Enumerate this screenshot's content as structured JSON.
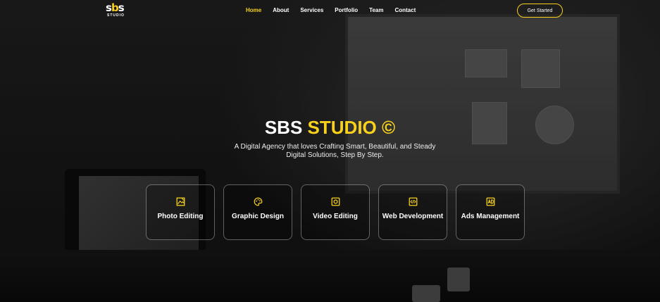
{
  "brand": {
    "logo_main": "sbs",
    "logo_sub": "STUDIO",
    "accent": "#f7d11b"
  },
  "nav": {
    "items": [
      {
        "label": "Home",
        "active": true
      },
      {
        "label": "About",
        "active": false
      },
      {
        "label": "Services",
        "active": false
      },
      {
        "label": "Portfolio",
        "active": false
      },
      {
        "label": "Team",
        "active": false
      },
      {
        "label": "Contact",
        "active": false
      }
    ],
    "cta_label": "Get Started"
  },
  "hero": {
    "title_white": "SBS",
    "title_yellow": "STUDIO ©",
    "subtitle_line1": "A Digital Agency that loves Crafting Smart, Beautiful, and Steady",
    "subtitle_line2": "Digital Solutions, Step By Step."
  },
  "services": [
    {
      "label": "Photo Editing",
      "icon": "image-edit-icon"
    },
    {
      "label": "Graphic Design",
      "icon": "palette-icon"
    },
    {
      "label": "Video Editing",
      "icon": "video-icon"
    },
    {
      "label": "Web Development",
      "icon": "code-icon"
    },
    {
      "label": "Ads Management",
      "icon": "ad-icon"
    }
  ]
}
